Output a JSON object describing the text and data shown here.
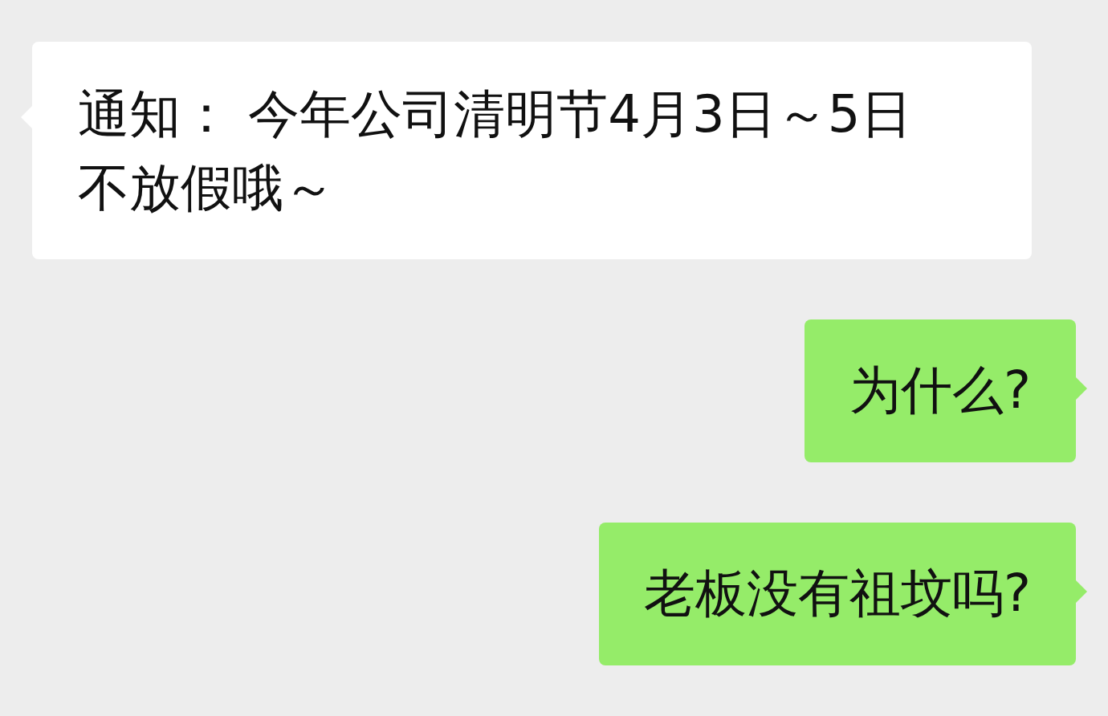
{
  "messages": [
    {
      "kind": "incoming",
      "text": "通知： 今年公司清明节4月3日～5日不放假哦～"
    },
    {
      "kind": "outgoing",
      "text": "为什么?"
    },
    {
      "kind": "outgoing",
      "text": "老板没有祖坟吗?"
    }
  ]
}
